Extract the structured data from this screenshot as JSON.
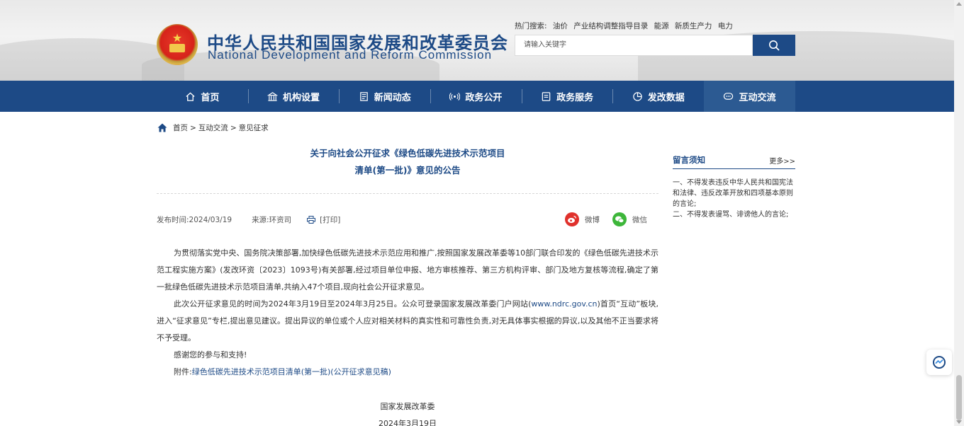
{
  "header": {
    "title_cn": "中华人民共和国国家发展和改革委员会",
    "title_en": "National Development and Reform Commission",
    "hot_label": "热门搜索:",
    "hot_terms": [
      "油价",
      "产业结构调整指导目录",
      "能源",
      "新质生产力",
      "电力"
    ],
    "search_placeholder": "请输入关键字"
  },
  "nav": {
    "items": [
      {
        "label": "首页",
        "icon": "home-icon"
      },
      {
        "label": "机构设置",
        "icon": "building-icon"
      },
      {
        "label": "新闻动态",
        "icon": "news-icon"
      },
      {
        "label": "政务公开",
        "icon": "broadcast-icon"
      },
      {
        "label": "政务服务",
        "icon": "service-icon"
      },
      {
        "label": "发改数据",
        "icon": "pie-chart-icon"
      },
      {
        "label": "互动交流",
        "icon": "chat-icon"
      }
    ],
    "active": "互动交流"
  },
  "breadcrumb": {
    "items": [
      "首页",
      "互动交流",
      "意见征求"
    ],
    "separator": ">"
  },
  "article": {
    "title_line1": "关于向社会公开征求《绿色低碳先进技术示范项目",
    "title_line2": "清单(第一批)》意见的公告",
    "date": "发布时间:2024/03/19",
    "source": "来源:环资司",
    "print": "[打印]",
    "share_weibo": "微博",
    "share_weixin": "微信",
    "p1": "为贯彻落实党中央、国务院决策部署,加快绿色低碳先进技术示范应用和推广,按照国家发展改革委等10部门联合印发的《绿色低碳先进技术示范工程实施方案》(发改环资〔2023〕1093号)有关部署,经过项目单位申报、地方审核推荐、第三方机构评审、部门及地方复核等流程,确定了第一批绿色低碳先进技术示范项目清单,共纳入47个项目,现向社会公开征求意见。",
    "p2_a": "此次公开征求意见的时间为2024年3月19日至2024年3月25日。公众可登录国家发展改革委门户网站(",
    "p2_link": "www.ndrc.gov.cn",
    "p2_b": ")首页“互动”板块,进入“征求意见”专栏,提出意见建议。提出异议的单位或个人应对相关材料的真实性和可靠性负责,对无具体事实根据的异议,以及其他不正当要求将不予受理。",
    "p3": "感谢您的参与和支持!",
    "attach_label": "附件:",
    "attach_link": "绿色低碳先进技术示范项目清单(第一批)(公开征求意见稿)",
    "sign_org": "国家发展改革委",
    "sign_date": "2024年3月19日"
  },
  "sidebar": {
    "title": "留言须知",
    "more": "更多>>",
    "text1": "一、不得发表违反中华人民共和国宪法和法律、违反改革开放和四项基本原则的言论;",
    "text2": "二、不得发表谩骂、诽谤他人的言论;"
  },
  "colors": {
    "brand_blue": "#1d4a86",
    "nav_active": "#2c5a92",
    "weibo_red": "#e0312c",
    "weixin_green": "#3db63a"
  }
}
